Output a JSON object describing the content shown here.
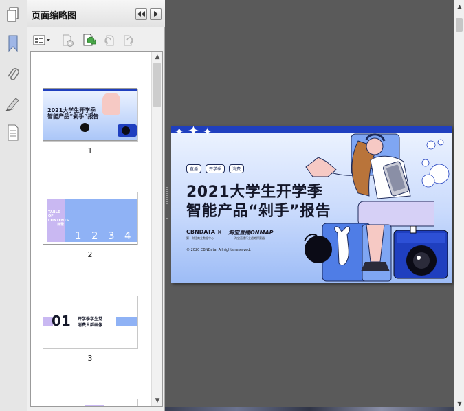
{
  "panel": {
    "title": "页面缩略图"
  },
  "icons": {
    "pages_panel": "pages-icon",
    "bookmarks": "bookmark-icon",
    "attachments": "paperclip-icon",
    "signatures": "signature-pen-icon",
    "layers": "document-layers-icon",
    "collapse": "double-chevron-left-icon",
    "expand": "chevron-right-icon",
    "options": "thumbnail-options-icon",
    "delete": "delete-page-icon",
    "insert": "insert-page-icon",
    "rotate_ccw": "rotate-left-icon",
    "rotate_cw": "rotate-right-icon"
  },
  "thumbnails": [
    {
      "number": "1"
    },
    {
      "number": "2"
    },
    {
      "number": "3"
    }
  ],
  "cover": {
    "tags": [
      "直播",
      "开学季",
      "消费"
    ],
    "title_line1": "2021大学生开学季",
    "title_line2": "智能产品“剁手”报告",
    "logo_cbn": "CBNDATA ×",
    "logo_cbn_sub": "第一财经商业数据中心",
    "logo_onmap": "淘宝直播ONMAP",
    "logo_onmap_sub": "淘宝直播行业趋势探索器",
    "copyright": "© 2020 CBNData. All rights reserved."
  },
  "thumb_texts": {
    "t1_line1": "2021大学生开学季",
    "t1_line2": "智能产品“剁手”报告",
    "t2_left1": "TABLE",
    "t2_left2": "OF",
    "t2_left3": "CONTENTS",
    "t2_left4": "目录",
    "t2_numbers": [
      "1",
      "2",
      "3",
      "4"
    ],
    "t3_number": "01",
    "t3_line1": "开学季学生党",
    "t3_line2": "消费人群画像"
  },
  "colors": {
    "brand_blue": "#1f3fbf",
    "cover_bg_top": "#eef4ff",
    "cover_bg_bottom": "#9dbcf6",
    "thumb2_accent": "#8fb2f5",
    "thumb2_purple": "#c9b8f2"
  }
}
